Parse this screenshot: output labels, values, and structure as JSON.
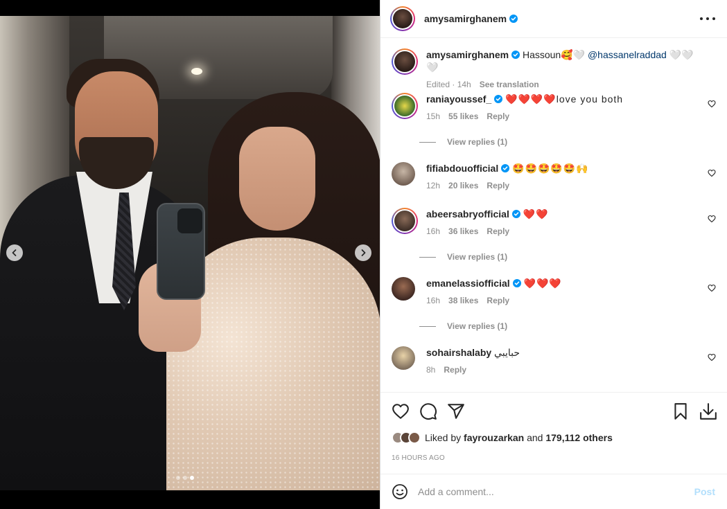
{
  "post": {
    "author": "amysamirghanem",
    "caption_text": "Hassoun🥰🤍 ",
    "caption_mention": "@hassanelraddad",
    "caption_tail": " 🤍🤍🤍",
    "edited_meta": "Edited · 14h",
    "see_translation": "See translation"
  },
  "comments": [
    {
      "user": "raniayoussef_",
      "verified": true,
      "text": "❤️❤️❤️❤️love you both",
      "time": "15h",
      "likes": "55 likes",
      "reply": "Reply",
      "view_replies": "View replies (1)"
    },
    {
      "user": "fifiabdouofficial",
      "verified": true,
      "text": "🤩🤩🤩🤩🤩🙌",
      "time": "12h",
      "likes": "20 likes",
      "reply": "Reply"
    },
    {
      "user": "abeersabryofficial",
      "verified": true,
      "text": "❤️❤️",
      "time": "16h",
      "likes": "36 likes",
      "reply": "Reply",
      "view_replies": "View replies (1)"
    },
    {
      "user": "emanelassiofficial",
      "verified": true,
      "text": "❤️❤️❤️",
      "time": "16h",
      "likes": "38 likes",
      "reply": "Reply",
      "view_replies": "View replies (1)"
    },
    {
      "user": "sohairshalaby",
      "verified": false,
      "text": "حبايبي",
      "time": "8h",
      "reply": "Reply"
    }
  ],
  "likes": {
    "prefix": "Liked by ",
    "user": "fayrouzarkan",
    "mid": " and ",
    "count": "179,112 others"
  },
  "timestamp": "16 HOURS AGO",
  "composer": {
    "placeholder": "Add a comment...",
    "post_label": "Post"
  },
  "carousel": {
    "count": 3,
    "active_index": 2
  },
  "icons": [
    "more-options-icon",
    "verified-icon",
    "heart-icon",
    "comment-icon",
    "share-icon",
    "bookmark-icon",
    "download-icon",
    "emoji-icon",
    "chevron-left-icon",
    "chevron-right-icon"
  ],
  "colors": {
    "verified": "#0095f6",
    "link": "#00376b",
    "muted": "#8e8e8e",
    "post_disabled": "#b2dffc"
  }
}
